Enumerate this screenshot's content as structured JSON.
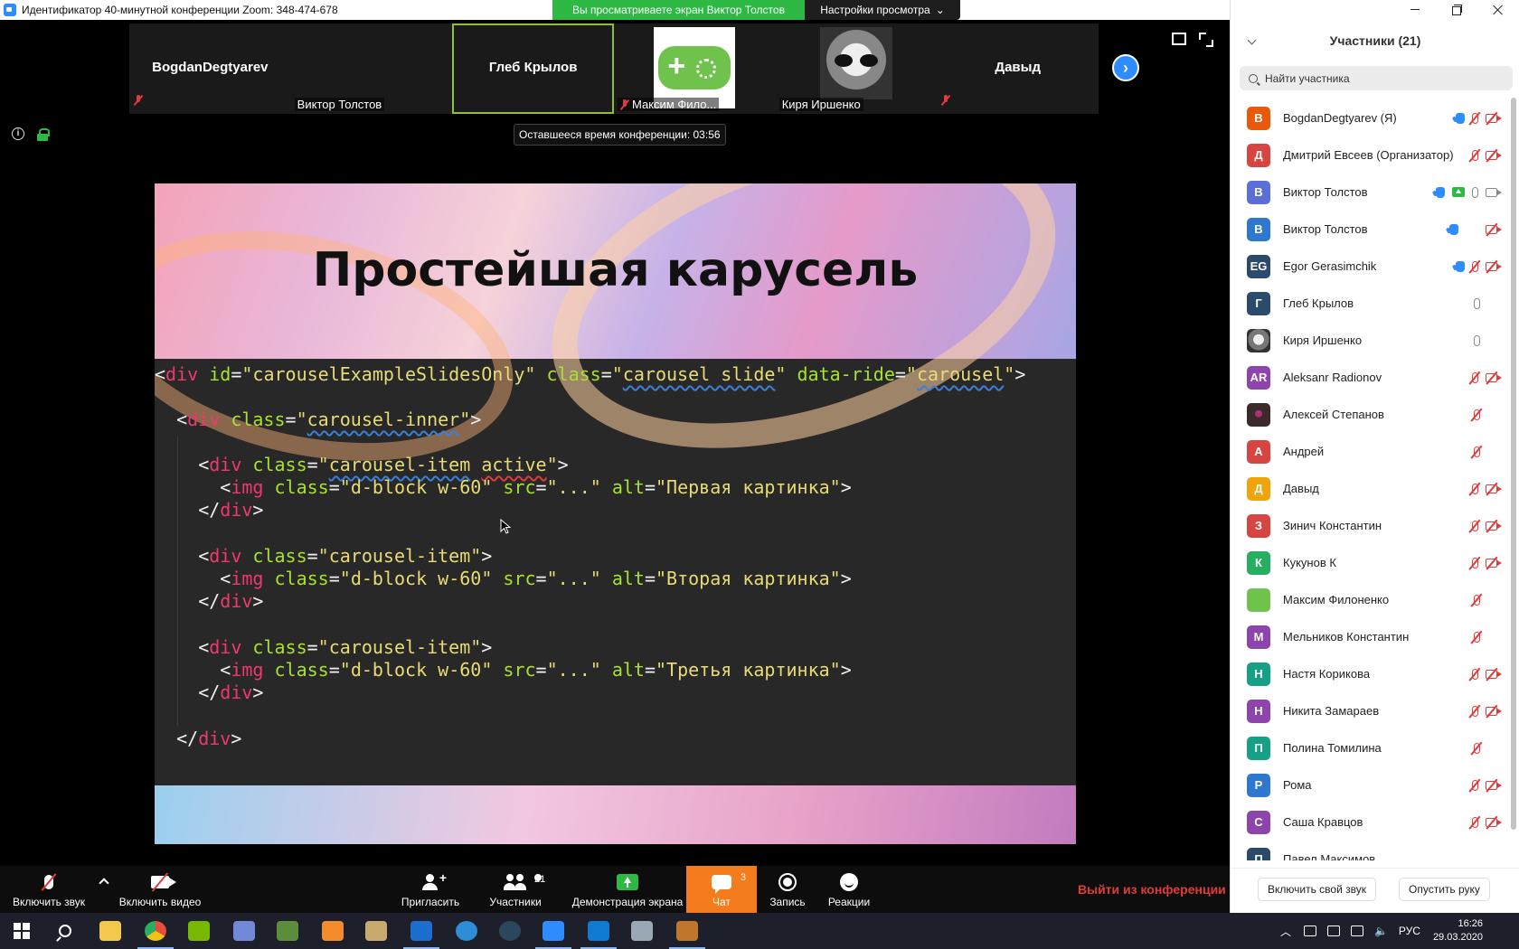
{
  "window": {
    "title": "Идентификатор 40-минутной конференции Zoom: 348-474-678",
    "viewing_banner": "Вы просматриваете экран Виктор Толстов",
    "view_settings": "Настройки просмотра"
  },
  "video_strip": {
    "tiles": [
      {
        "name": "BogdanDegtyarev",
        "label": "",
        "muted": true
      },
      {
        "name": "",
        "label": "Виктор Толстов",
        "muted": false
      },
      {
        "name": "Глеб Крылов",
        "label": "",
        "muted": false,
        "active": true
      },
      {
        "name": "",
        "label": "Максим Фило...",
        "muted": true,
        "avatar": "game-controller"
      },
      {
        "name": "",
        "label": "Киря Иршенко",
        "muted": false,
        "avatar": "cat-photo"
      },
      {
        "name": "Давыд",
        "label": "",
        "muted": true
      }
    ]
  },
  "meeting": {
    "time_left": "Оставшееся время конференции: 03:56"
  },
  "slide": {
    "title": "Простейшая карусель",
    "code_lines": [
      "<div id=\"carouselExampleSlidesOnly\" class=\"carousel slide\" data-ride=\"carousel\">",
      "<div class=\"carousel-inner\">",
      "<div class=\"carousel-item active\">",
      "<img class=\"d-block w-60\" src=\"...\" alt=\"Первая картинка\">",
      "</div>",
      "<div class=\"carousel-item\">",
      "<img class=\"d-block w-60\" src=\"...\" alt=\"Вторая картинка\">",
      "</div>",
      "<div class=\"carousel-item\">",
      "<img class=\"d-block w-60\" src=\"...\" alt=\"Третья картинка\">",
      "</div>",
      "</div>"
    ]
  },
  "toolbar": {
    "unmute": "Включить звук",
    "start_video": "Включить видео",
    "invite": "Пригласить",
    "participants": "Участники",
    "participants_count": "21",
    "share_screen": "Демонстрация экрана",
    "chat": "Чат",
    "chat_badge": "3",
    "record": "Запись",
    "reactions": "Реакции",
    "leave": "Выйти из конференции"
  },
  "panel": {
    "title": "Участники (21)",
    "search_placeholder": "Найти участника",
    "unmute_self": "Включить свой звук",
    "lower_hand": "Опустить руку",
    "participants": [
      {
        "initials": "B",
        "name": "BogdanDegtyarev (Я)",
        "color": "#e8590c",
        "hand": true,
        "share": false,
        "mic": "off",
        "cam": "off"
      },
      {
        "initials": "Д",
        "name": "Дмитрий Евсеев (Организатор)",
        "color": "#d64541",
        "hand": false,
        "share": false,
        "mic": "off",
        "cam": "off"
      },
      {
        "initials": "В",
        "name": "Виктор Толстов",
        "color": "#5b6fd6",
        "hand": true,
        "share": true,
        "mic": "on",
        "cam": "on"
      },
      {
        "initials": "В",
        "name": "Виктор Толстов",
        "color": "#2f78d0",
        "hand": true,
        "share": false,
        "mic": "none",
        "cam": "off"
      },
      {
        "initials": "EG",
        "name": "Egor Gerasimchik",
        "color": "#2c4a6b",
        "hand": true,
        "share": false,
        "mic": "off",
        "cam": "off"
      },
      {
        "initials": "Г",
        "name": "Глеб Крылов",
        "color": "#2c4a6b",
        "hand": false,
        "share": false,
        "mic": "on",
        "cam": "none"
      },
      {
        "initials": "",
        "name": "Киря Иршенко",
        "color": "cat",
        "hand": false,
        "share": false,
        "mic": "on",
        "cam": "none"
      },
      {
        "initials": "AR",
        "name": "Aleksanr Radionov",
        "color": "#8e44ad",
        "hand": false,
        "share": false,
        "mic": "off",
        "cam": "off"
      },
      {
        "initials": "",
        "name": "Алексей Степанов",
        "color": "dark",
        "hand": false,
        "share": false,
        "mic": "off",
        "cam": "none"
      },
      {
        "initials": "А",
        "name": "Андрей",
        "color": "#d64541",
        "hand": false,
        "share": false,
        "mic": "off",
        "cam": "none"
      },
      {
        "initials": "Д",
        "name": "Давыд",
        "color": "#f0a30a",
        "hand": false,
        "share": false,
        "mic": "off",
        "cam": "off"
      },
      {
        "initials": "З",
        "name": "Зинич Константин",
        "color": "#d64541",
        "hand": false,
        "share": false,
        "mic": "off",
        "cam": "off"
      },
      {
        "initials": "К",
        "name": "Кукунов К",
        "color": "#27ae60",
        "hand": false,
        "share": false,
        "mic": "off",
        "cam": "off"
      },
      {
        "initials": "",
        "name": "Максим Филоненко",
        "color": "game",
        "hand": false,
        "share": false,
        "mic": "off",
        "cam": "none"
      },
      {
        "initials": "М",
        "name": "Мельников Константин",
        "color": "#8e44ad",
        "hand": false,
        "share": false,
        "mic": "off",
        "cam": "none"
      },
      {
        "initials": "Н",
        "name": "Настя Корикова",
        "color": "#16a085",
        "hand": false,
        "share": false,
        "mic": "off",
        "cam": "off"
      },
      {
        "initials": "Н",
        "name": "Никита Замараев",
        "color": "#8e44ad",
        "hand": false,
        "share": false,
        "mic": "off",
        "cam": "off"
      },
      {
        "initials": "П",
        "name": "Полина Томилина",
        "color": "#16a085",
        "hand": false,
        "share": false,
        "mic": "off",
        "cam": "none"
      },
      {
        "initials": "Р",
        "name": "Рома",
        "color": "#2f78d0",
        "hand": false,
        "share": false,
        "mic": "off",
        "cam": "off"
      },
      {
        "initials": "С",
        "name": "Саша Кравцов",
        "color": "#8e44ad",
        "hand": false,
        "share": false,
        "mic": "off",
        "cam": "off"
      },
      {
        "initials": "П",
        "name": "Павел Максимов",
        "color": "#2c4a6b",
        "hand": false,
        "share": false,
        "mic": "none",
        "cam": "none"
      }
    ]
  },
  "taskbar": {
    "apps": [
      "start-icon",
      "search-icon",
      "file-explorer-icon",
      "chrome-icon",
      "nvidia-icon",
      "discord-icon",
      "minecraft-icon",
      "sublime-icon",
      "league-icon",
      "app-icon",
      "tor-icon",
      "steam-icon",
      "zoom-icon",
      "vscode-icon",
      "photo-icon",
      "game-icon"
    ],
    "language": "РУС",
    "time": "16:26",
    "date": "29.03.2020"
  }
}
